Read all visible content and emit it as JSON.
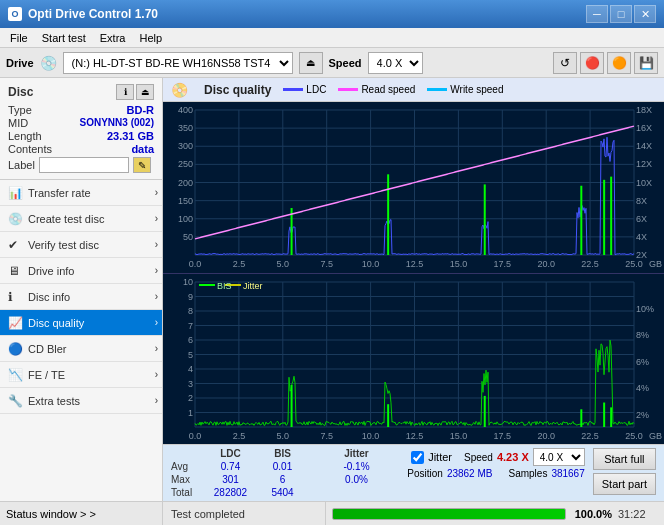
{
  "titlebar": {
    "title": "Opti Drive Control 1.70",
    "icon_text": "O",
    "minimize": "─",
    "maximize": "□",
    "close": "✕"
  },
  "menu": {
    "items": [
      "File",
      "Start test",
      "Extra",
      "Help"
    ]
  },
  "drivebar": {
    "label": "Drive",
    "drive_value": "(N:) HL-DT-ST BD-RE  WH16NS58 TST4",
    "speed_label": "Speed",
    "speed_value": "4.0 X"
  },
  "disc": {
    "title": "Disc",
    "type_label": "Type",
    "type_val": "BD-R",
    "mid_label": "MID",
    "mid_val": "SONYNN3 (002)",
    "length_label": "Length",
    "length_val": "23.31 GB",
    "contents_label": "Contents",
    "contents_val": "data",
    "label_label": "Label"
  },
  "nav": {
    "items": [
      {
        "id": "transfer-rate",
        "label": "Transfer rate",
        "active": false
      },
      {
        "id": "create-test-disc",
        "label": "Create test disc",
        "active": false
      },
      {
        "id": "verify-test-disc",
        "label": "Verify test disc",
        "active": false
      },
      {
        "id": "drive-info",
        "label": "Drive info",
        "active": false
      },
      {
        "id": "disc-info",
        "label": "Disc info",
        "active": false
      },
      {
        "id": "disc-quality",
        "label": "Disc quality",
        "active": true
      },
      {
        "id": "cd-bler",
        "label": "CD Bler",
        "active": false
      },
      {
        "id": "fe-te",
        "label": "FE / TE",
        "active": false
      },
      {
        "id": "extra-tests",
        "label": "Extra tests",
        "active": false
      }
    ]
  },
  "status_window_label": "Status window > >",
  "disc_quality": {
    "title": "Disc quality",
    "legend": [
      {
        "id": "ldc",
        "label": "LDC",
        "color": "#4444ff"
      },
      {
        "id": "read-speed",
        "label": "Read speed",
        "color": "#ff44ff"
      },
      {
        "id": "write-speed",
        "label": "Write speed",
        "color": "#00bbff"
      }
    ],
    "chart1": {
      "y_max": 400,
      "y_right_max": 18,
      "x_labels": [
        "0.0",
        "2.5",
        "5.0",
        "7.5",
        "10.0",
        "12.5",
        "15.0",
        "17.5",
        "20.0",
        "22.5",
        "25.0"
      ],
      "y_right_labels": [
        "18X",
        "16X",
        "14X",
        "12X",
        "10X",
        "8X",
        "6X",
        "4X",
        "2X"
      ]
    },
    "chart2": {
      "y_max": 10,
      "x_labels": [
        "0.0",
        "2.5",
        "5.0",
        "7.5",
        "10.0",
        "12.5",
        "15.0",
        "17.5",
        "20.0",
        "22.5",
        "25.0"
      ],
      "legend": [
        {
          "id": "bis",
          "label": "BIS",
          "color": "#00ff00"
        },
        {
          "id": "jitter",
          "label": "Jitter",
          "color": "#ffff00"
        }
      ],
      "y_right_labels": [
        "10%",
        "8%",
        "6%",
        "4%",
        "2%"
      ]
    }
  },
  "stats": {
    "headers": [
      "",
      "LDC",
      "BIS",
      "",
      "Jitter"
    ],
    "avg_label": "Avg",
    "avg_ldc": "0.74",
    "avg_bis": "0.01",
    "avg_jitter": "-0.1%",
    "max_label": "Max",
    "max_ldc": "301",
    "max_bis": "6",
    "max_jitter": "0.0%",
    "total_label": "Total",
    "total_ldc": "282802",
    "total_bis": "5404",
    "jitter_checked": true,
    "jitter_label": "Jitter",
    "speed_label": "Speed",
    "speed_val": "4.23 X",
    "speed_select": "4.0 X",
    "position_label": "Position",
    "position_val": "23862 MB",
    "samples_label": "Samples",
    "samples_val": "381667",
    "start_full_label": "Start full",
    "start_part_label": "Start part"
  },
  "bottom_status": {
    "text": "Test completed",
    "progress_pct": "100.0%",
    "time": "31:22"
  }
}
